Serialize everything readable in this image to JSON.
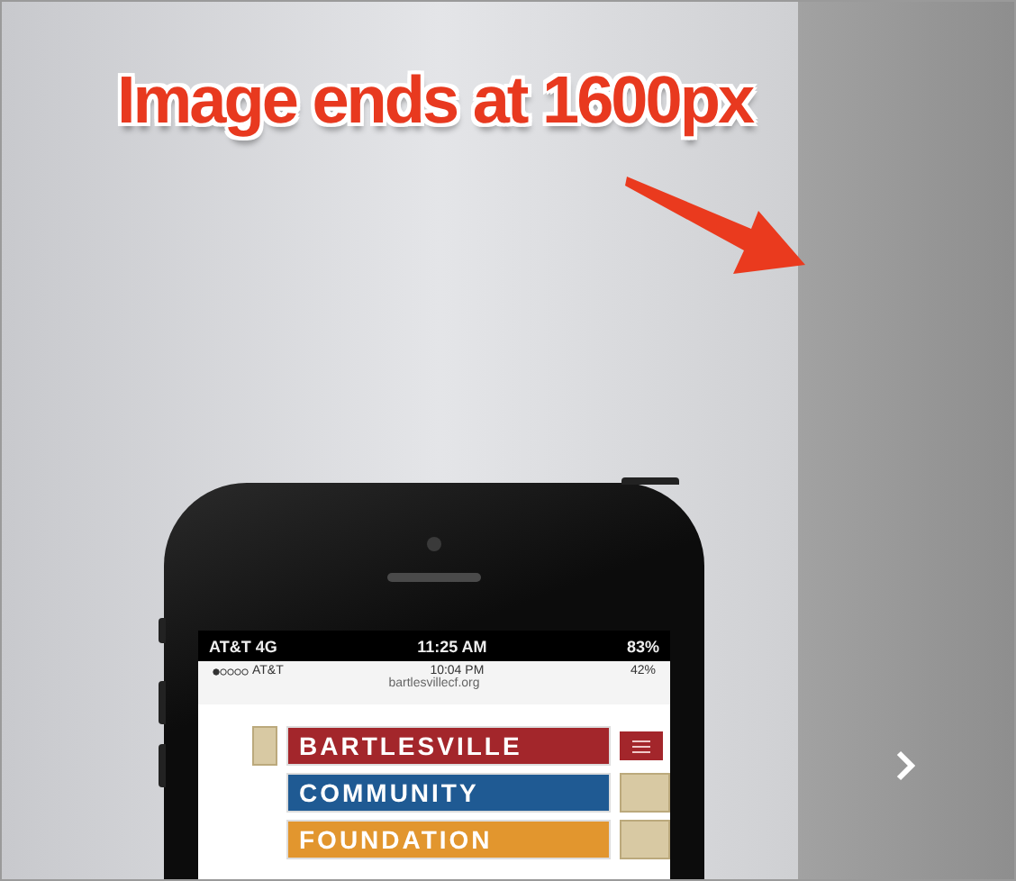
{
  "annotation": {
    "text": "Image ends at 1600px"
  },
  "phone": {
    "status_bar": {
      "carrier": "AT&T",
      "network": "4G",
      "time": "11:25 AM",
      "battery": "83%"
    },
    "browser": {
      "status_bar": {
        "carrier": "AT&T",
        "time": "10:04 PM",
        "battery": "42%"
      },
      "url": "bartlesvillecf.org"
    },
    "logo": {
      "lines": [
        {
          "text": "BARTLESVILLE",
          "color": "#a3262b"
        },
        {
          "text": "COMMUNITY",
          "color": "#1f5a93"
        },
        {
          "text": "FOUNDATION",
          "color": "#e2962e"
        }
      ]
    }
  }
}
